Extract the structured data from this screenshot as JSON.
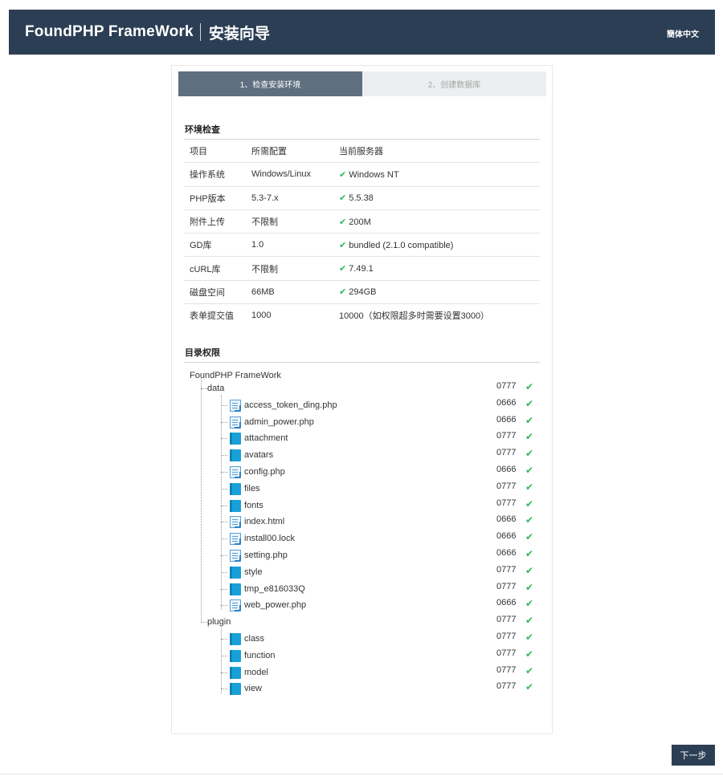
{
  "header": {
    "brand": "FoundPHP FrameWork",
    "subtitle": "安装向导",
    "language": "簡体中文"
  },
  "steps": [
    {
      "label": "1、检查安装环境",
      "active": true
    },
    {
      "label": "2、创建数据库",
      "active": false
    }
  ],
  "env": {
    "title": "环境检查",
    "columns": [
      "项目",
      "所需配置",
      "当前服务器"
    ],
    "rows": [
      {
        "item": "操作系统",
        "required": "Windows/Linux",
        "current": "Windows NT",
        "ok": true
      },
      {
        "item": "PHP版本",
        "required": "5.3-7.x",
        "current": "5.5.38",
        "ok": true
      },
      {
        "item": "附件上传",
        "required": "不限制",
        "current": "200M",
        "ok": true
      },
      {
        "item": "GD库",
        "required": "1.0",
        "current": "bundled (2.1.0 compatible)",
        "ok": true
      },
      {
        "item": "cURL库",
        "required": "不限制",
        "current": "7.49.1",
        "ok": true
      },
      {
        "item": "磁盘空间",
        "required": "66MB",
        "current": "294GB",
        "ok": true
      },
      {
        "item": "表单提交值",
        "required": "1000",
        "current": "10000（如权限超多时需要设置3000）",
        "ok": false
      }
    ]
  },
  "dirs": {
    "title": "目录权限",
    "root": "FoundPHP FrameWork",
    "groups": [
      {
        "name": "data",
        "perm": "0777",
        "children": [
          {
            "name": "access_token_ding.php",
            "type": "file",
            "perm": "0666"
          },
          {
            "name": "admin_power.php",
            "type": "file",
            "perm": "0666"
          },
          {
            "name": "attachment",
            "type": "folder",
            "perm": "0777"
          },
          {
            "name": "avatars",
            "type": "folder",
            "perm": "0777"
          },
          {
            "name": "config.php",
            "type": "file",
            "perm": "0666"
          },
          {
            "name": "files",
            "type": "folder",
            "perm": "0777"
          },
          {
            "name": "fonts",
            "type": "folder",
            "perm": "0777"
          },
          {
            "name": "index.html",
            "type": "file",
            "perm": "0666"
          },
          {
            "name": "install00.lock",
            "type": "file",
            "perm": "0666"
          },
          {
            "name": "setting.php",
            "type": "file",
            "perm": "0666"
          },
          {
            "name": "style",
            "type": "folder",
            "perm": "0777"
          },
          {
            "name": "tmp_e816033Q",
            "type": "folder",
            "perm": "0777"
          },
          {
            "name": "web_power.php",
            "type": "file",
            "perm": "0666"
          }
        ]
      },
      {
        "name": "plugin",
        "perm": "0777",
        "children": [
          {
            "name": "class",
            "type": "folder",
            "perm": "0777"
          },
          {
            "name": "function",
            "type": "folder",
            "perm": "0777"
          },
          {
            "name": "model",
            "type": "folder",
            "perm": "0777"
          },
          {
            "name": "view",
            "type": "folder",
            "perm": "0777"
          }
        ]
      }
    ]
  },
  "footer": {
    "next_label": "下一步"
  },
  "colors": {
    "header_bg": "#2c3e54",
    "active_step_bg": "#5e6f7f",
    "ok_green": "#2fb957",
    "folder_blue": "#1aa0d8"
  },
  "icons": {
    "ok": "check-icon",
    "folder": "folder-icon",
    "file": "file-icon"
  }
}
